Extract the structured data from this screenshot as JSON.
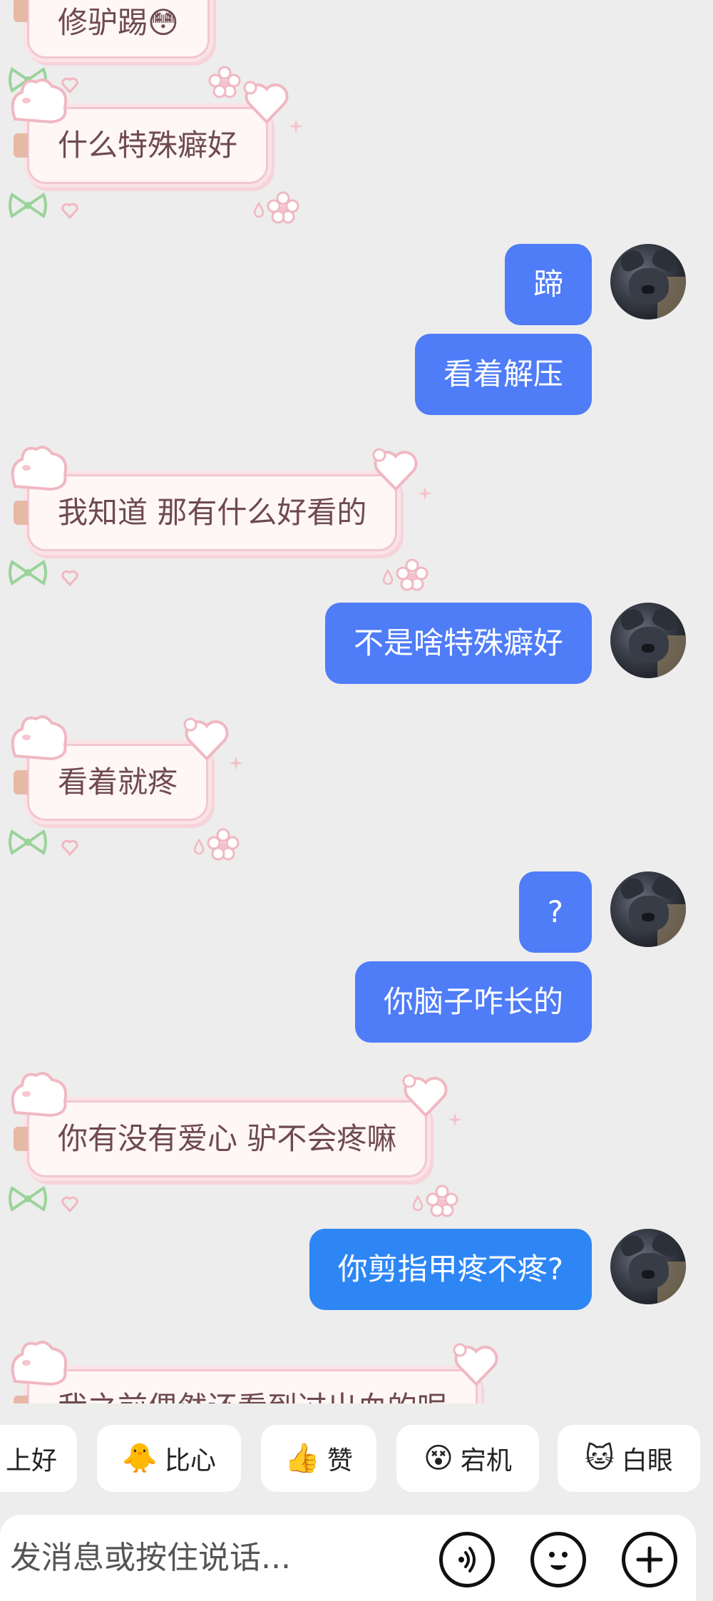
{
  "messages": [
    {
      "side": "in",
      "text": "修驴踢😳"
    },
    {
      "side": "in",
      "text": "什么特殊癖好"
    },
    {
      "side": "out",
      "text": "蹄"
    },
    {
      "side": "out",
      "text": "看着解压"
    },
    {
      "side": "in",
      "text": "我知道 那有什么好看的"
    },
    {
      "side": "out",
      "text": "不是啥特殊癖好"
    },
    {
      "side": "in",
      "text": "看着就疼"
    },
    {
      "side": "out",
      "text": "?"
    },
    {
      "side": "out",
      "text": "你脑子咋长的"
    },
    {
      "side": "in",
      "text": "你有没有爱心 驴不会疼嘛"
    },
    {
      "side": "out",
      "text": "你剪指甲疼不疼?"
    },
    {
      "side": "in",
      "text": "我之前偶然还看到过出血的呢"
    }
  ],
  "quick_replies": [
    {
      "label": "上好",
      "icon": ""
    },
    {
      "label": "比心",
      "icon": "🐥"
    },
    {
      "label": "赞",
      "icon": "👍"
    },
    {
      "label": "宕机",
      "icon": "😵"
    },
    {
      "label": "白眼",
      "icon": "🐱"
    }
  ],
  "input": {
    "placeholder": "发消息或按住说话..."
  },
  "colors": {
    "outgoing_bubble": "#4f7cf7",
    "background": "#ededed",
    "incoming_text": "#6e4a4e"
  }
}
